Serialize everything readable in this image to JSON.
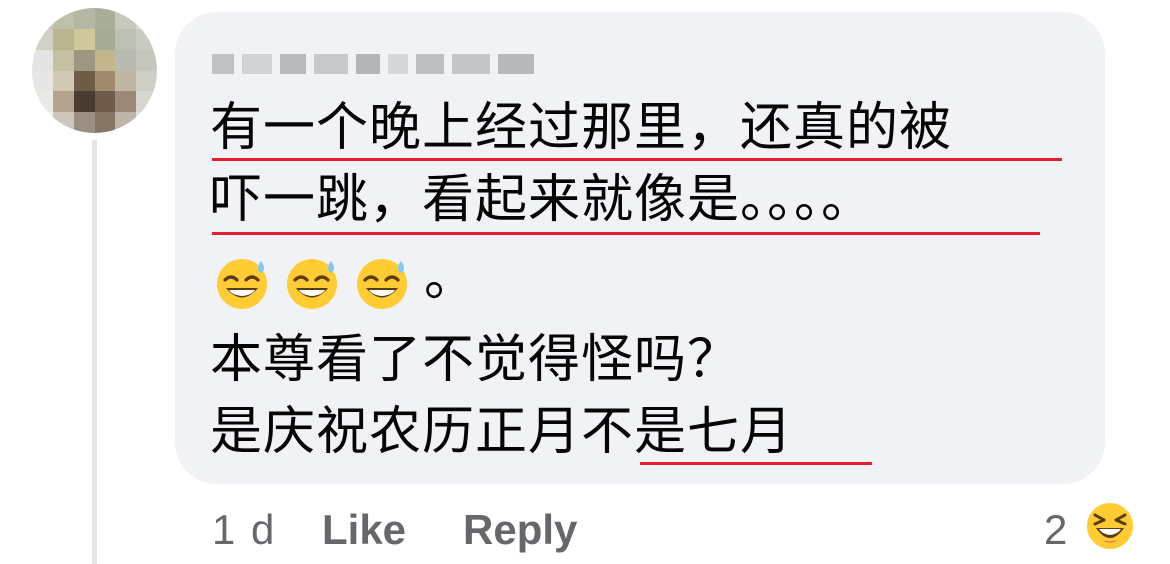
{
  "comment": {
    "author_name": "",
    "lines": [
      "有一个晚上经过那里，还真的被",
      "吓一跳，看起来就像是。。。。",
      "。",
      "本尊看了不觉得怪吗？",
      "是庆祝农历正月不是七月"
    ]
  },
  "actions": {
    "time": "1 d",
    "like_label": "Like",
    "reply_label": "Reply"
  },
  "reactions": {
    "count": "2",
    "icon": "laughing-emoji-icon"
  },
  "emojis": [
    "grinning-sweat-icon",
    "grinning-sweat-icon",
    "grinning-sweat-icon"
  ],
  "colors": {
    "bubble": "#f0f2f5",
    "underline": "#e41e2f",
    "meta_text": "#65676b"
  }
}
